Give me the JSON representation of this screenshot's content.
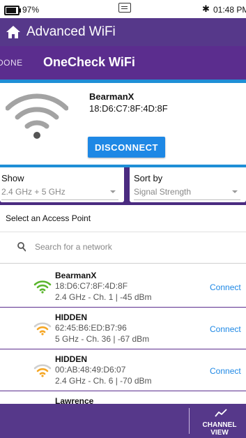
{
  "status_bar": {
    "battery": "97%",
    "time": "01:48 PM"
  },
  "app_bar": {
    "title": "Advanced WiFi"
  },
  "sub_bar": {
    "done_label": "DONE",
    "title": "OneCheck WiFi"
  },
  "connected_network": {
    "ssid": "BearmanX",
    "mac": "18:D6:C7:8F:4D:8F",
    "disconnect_label": "DISCONNECT"
  },
  "filters": {
    "show": {
      "label": "Show",
      "value": "2.4 GHz + 5 GHz"
    },
    "sort": {
      "label": "Sort by",
      "value": "Signal Strength"
    }
  },
  "list_header": "Select an Access Point",
  "search": {
    "placeholder": "Search for a network"
  },
  "access_points": [
    {
      "ssid": "BearmanX",
      "mac": "18:D6:C7:8F:4D:8F",
      "info": "2.4 GHz - Ch. 1 | -45 dBm",
      "action": "Connect",
      "signal_color": "#5ab52d"
    },
    {
      "ssid": "HIDDEN",
      "mac": "62:45:B6:ED:B7:96",
      "info": "5 GHz - Ch. 36 | -67 dBm",
      "action": "Connect",
      "signal_color": "#f5a623"
    },
    {
      "ssid": "HIDDEN",
      "mac": "00:AB:48:49:D6:07",
      "info": "2.4 GHz - Ch. 6 | -70 dBm",
      "action": "Connect",
      "signal_color": "#f5a623"
    },
    {
      "ssid": "Lawrence",
      "mac": "",
      "info": "",
      "action": "",
      "signal_color": "#f5a623"
    }
  ],
  "bottom_bar": {
    "channel_view_label": "CHANNEL\nVIEW"
  },
  "colors": {
    "brand_purple": "#56388a",
    "accent_blue": "#1e88e5"
  }
}
